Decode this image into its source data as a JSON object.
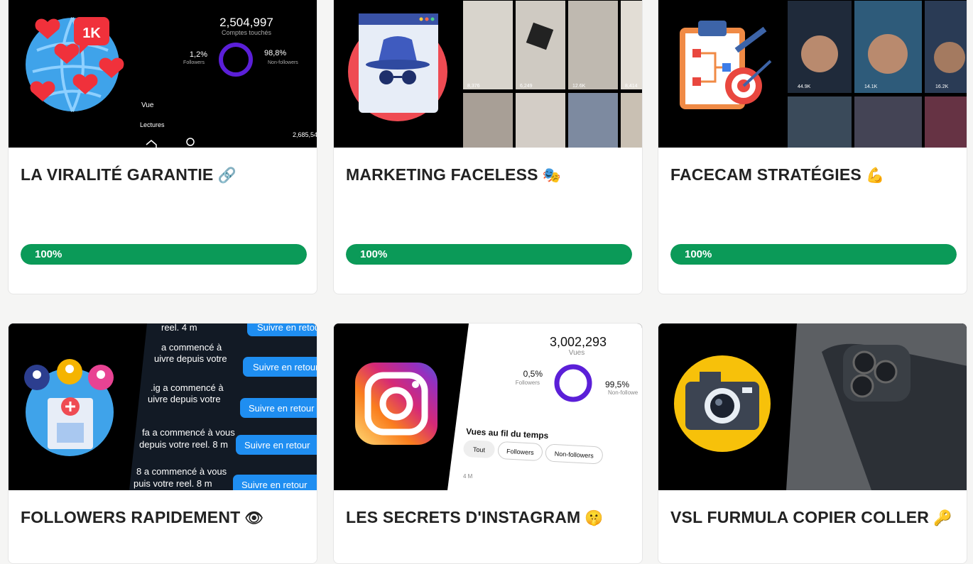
{
  "courses": [
    {
      "title": "LA VIRALITÉ GARANTIE",
      "emoji": "🔗",
      "progress": 100,
      "progress_label": "100%",
      "thumb_text": {
        "accounts_reached_value": "2,504,997",
        "accounts_reached_label": "Comptes touchés",
        "followers_pct": "1,2%",
        "followers_label": "Followers",
        "non_followers_pct": "98,8%",
        "non_followers_label": "Non-followers",
        "badge": "1K",
        "vue": "Vue",
        "lectures": "Lectures",
        "count": "2,685,54"
      }
    },
    {
      "title": "MARKETING FACELESS",
      "emoji": "🎭",
      "progress": 100,
      "progress_label": "100%",
      "thumb_text": {
        "view_counts": [
          "8,376",
          "6,249",
          "12.6K",
          "8,414"
        ]
      }
    },
    {
      "title": "FACECAM STRATÉGIES",
      "emoji": "💪",
      "progress": 100,
      "progress_label": "100%",
      "thumb_text": {
        "view_counts": [
          "44.9K",
          "14.1K",
          "16.2K"
        ]
      }
    },
    {
      "title": "FOLLOWERS RAPIDEMENT",
      "emoji": "👁",
      "thumb_text": {
        "follow_button": "Suivre en retour",
        "lines": [
          "reel. 4 m",
          "a commencé à",
          "uivre depuis votre",
          ".ig a commencé à",
          "uivre depuis votre",
          "fa a commencé à vous",
          "depuis votre reel. 8 m",
          "8 a commencé à vous",
          "puis votre reel. 8 m"
        ]
      }
    },
    {
      "title": "LES SECRETS D'INSTAGRAM",
      "emoji": "🤫",
      "thumb_text": {
        "views_value": "3,002,293",
        "views_label": "Vues",
        "followers_pct": "0,5%",
        "followers_label": "Followers",
        "non_followers_pct": "99,5%",
        "non_followers_label": "Non-followe",
        "chart_title": "Vues au fil du temps",
        "filters": [
          "Tout",
          "Followers",
          "Non-followers"
        ],
        "axis_label": "4 M"
      }
    },
    {
      "title": "VSL FURMULA COPIER COLLER",
      "emoji": "🔑"
    }
  ],
  "colors": {
    "progress_fill": "#0b9a58",
    "progress_track": "#e0e0e0",
    "title_text": "#222222",
    "instagram_purple": "#5b1fd8",
    "instagram_pink": "#e1306c"
  },
  "icons": [
    "globe-icon",
    "heart-icon",
    "spy-icon",
    "clipboard-icon",
    "target-icon",
    "users-icon",
    "instagram-icon",
    "camera-icon",
    "home-icon",
    "search-icon"
  ]
}
